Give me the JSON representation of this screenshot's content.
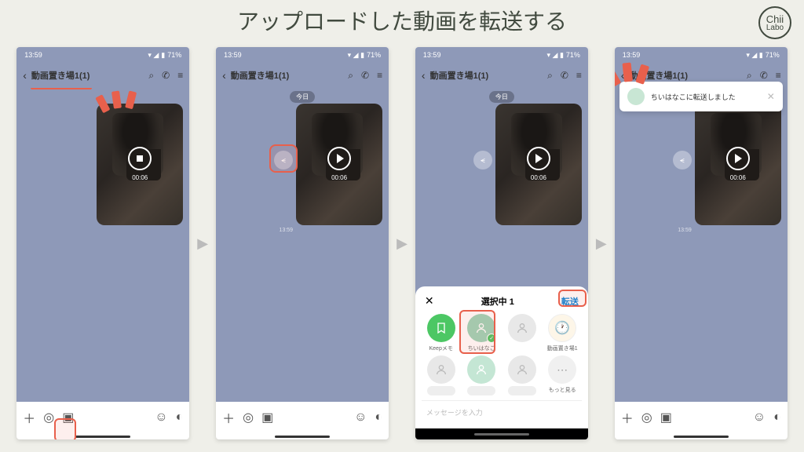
{
  "header": {
    "title": "アップロードした動画を転送する",
    "logo": "Chii Labo"
  },
  "status": {
    "time": "13:59",
    "battery": "71%"
  },
  "chat": {
    "name": "動画置き場1(1)",
    "date": "今日",
    "duration": "00:06",
    "time": "13:59"
  },
  "sheet": {
    "title": "選択中 1",
    "send": "転送",
    "contacts": [
      {
        "label": "Keepメモ"
      },
      {
        "label": "ちいはなこ"
      },
      {
        "label": ""
      },
      {
        "label": "動画置き場1"
      }
    ],
    "more": "もっと見る",
    "placeholder": "メッセージを入力"
  },
  "toast": {
    "text": "ちいはなこに転送しました"
  }
}
